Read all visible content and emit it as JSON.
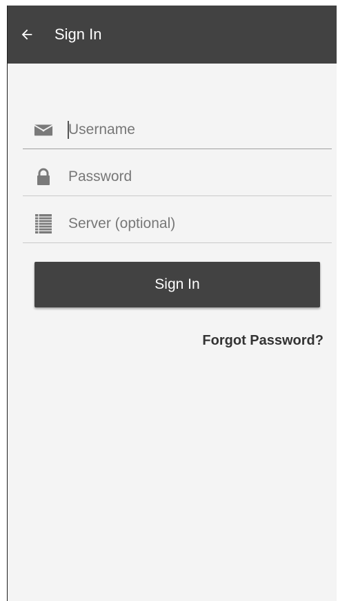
{
  "appbar": {
    "title": "Sign In",
    "back_icon": "arrow-left-icon",
    "background": "#424242"
  },
  "form": {
    "username": {
      "placeholder": "Username",
      "value": "",
      "icon": "envelope-icon"
    },
    "password": {
      "placeholder": "Password",
      "value": "",
      "icon": "lock-icon"
    },
    "server": {
      "placeholder": "Server (optional)",
      "value": "",
      "icon": "server-list-icon"
    }
  },
  "actions": {
    "sign_in_label": "Sign In",
    "forgot_password_label": "Forgot Password?"
  },
  "colors": {
    "button": "#424242",
    "background": "#f4f4f4",
    "icon": "#7a7a7a"
  }
}
